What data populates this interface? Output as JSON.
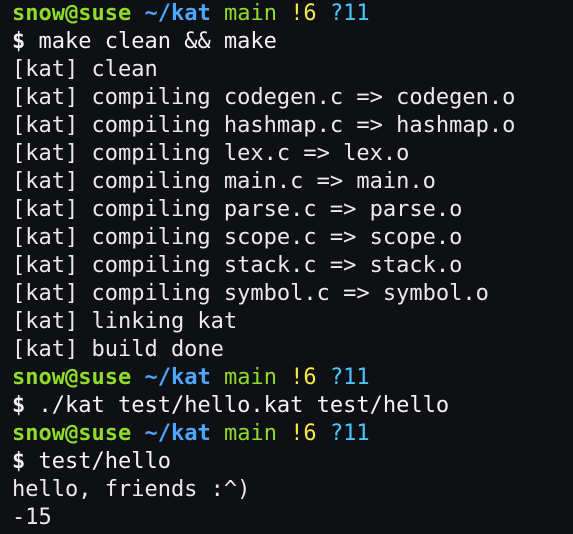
{
  "colors": {
    "background": "#0f1014",
    "foreground": "#e9e9ee",
    "prompt_user": "#8fdc2b",
    "prompt_path": "#4ea7ff",
    "prompt_branch": "#8fdc2b",
    "prompt_modified": "#f5e84a",
    "prompt_untracked": "#49c8ff"
  },
  "prompt": {
    "user_host": "snow@suse",
    "path": "~/kat",
    "branch": "main",
    "modified": "!6",
    "untracked": "?11",
    "symbol": "$"
  },
  "lines": [
    {
      "type": "prompt"
    },
    {
      "type": "command",
      "text": "make clean && make"
    },
    {
      "type": "output",
      "text": "[kat] clean"
    },
    {
      "type": "output",
      "text": "[kat] compiling codegen.c => codegen.o"
    },
    {
      "type": "output",
      "text": "[kat] compiling hashmap.c => hashmap.o"
    },
    {
      "type": "output",
      "text": "[kat] compiling lex.c => lex.o"
    },
    {
      "type": "output",
      "text": "[kat] compiling main.c => main.o"
    },
    {
      "type": "output",
      "text": "[kat] compiling parse.c => parse.o"
    },
    {
      "type": "output",
      "text": "[kat] compiling scope.c => scope.o"
    },
    {
      "type": "output",
      "text": "[kat] compiling stack.c => stack.o"
    },
    {
      "type": "output",
      "text": "[kat] compiling symbol.c => symbol.o"
    },
    {
      "type": "output",
      "text": "[kat] linking kat"
    },
    {
      "type": "output",
      "text": "[kat] build done"
    },
    {
      "type": "prompt"
    },
    {
      "type": "command",
      "text": "./kat test/hello.kat test/hello"
    },
    {
      "type": "prompt"
    },
    {
      "type": "command",
      "text": "test/hello"
    },
    {
      "type": "output",
      "text": "hello, friends :^)"
    },
    {
      "type": "output",
      "text": "-15"
    }
  ]
}
